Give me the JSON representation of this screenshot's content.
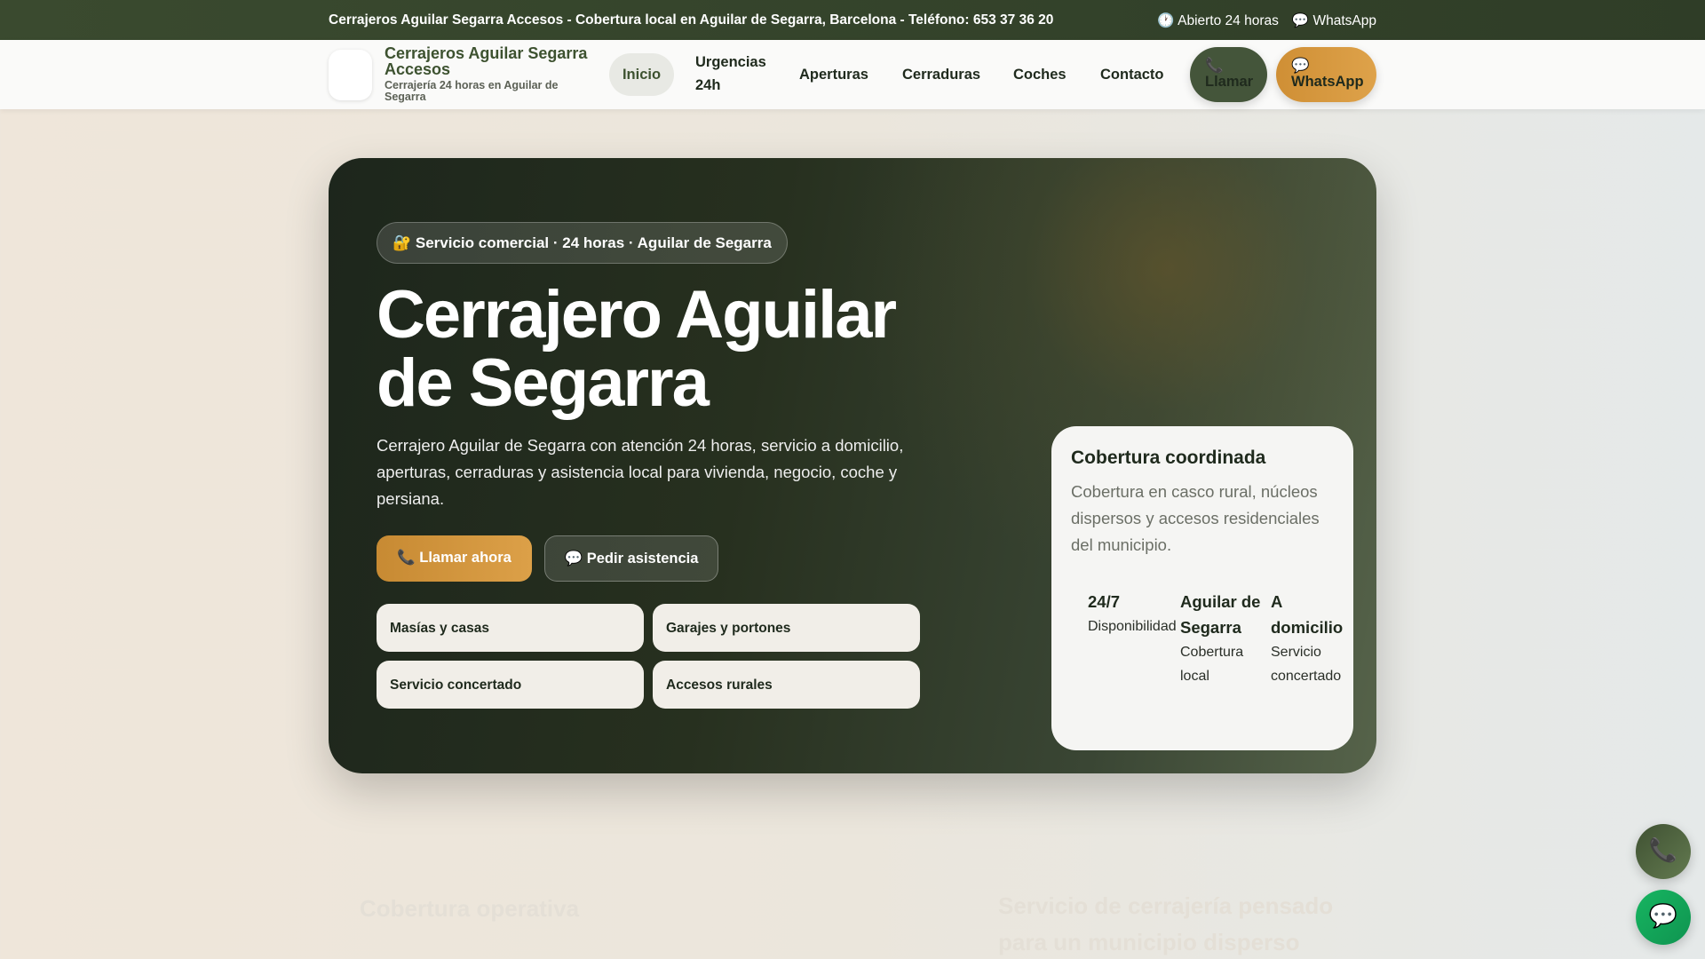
{
  "topbar": {
    "message": "Cerrajeros Aguilar Segarra Accesos - Cobertura local en Aguilar de Segarra, Barcelona - Teléfono: 653 37 36 20",
    "hours": "🕐 Abierto 24 horas",
    "whatsapp": "💬 WhatsApp"
  },
  "nav": {
    "brand_title": "Cerrajeros Aguilar Segarra Accesos",
    "brand_subtitle": "Cerrajería 24 horas en Aguilar de Segarra",
    "links": [
      "Inicio",
      "Urgencias 24h",
      "Aperturas",
      "Cerraduras",
      "Coches",
      "Contacto"
    ],
    "call_icon": "📞",
    "call_label": "Llamar",
    "wa_icon": "💬",
    "wa_label": "WhatsApp"
  },
  "hero": {
    "badge": "🔐 Servicio comercial · 24 horas · Aguilar de Segarra",
    "title": "Cerrajero Aguilar de Segarra",
    "lead": "Cerrajero Aguilar de Segarra con atención 24 horas, servicio a domicilio, aperturas, cerraduras y asistencia local para vivienda, negocio, coche y persiana.",
    "cta_call": "📞 Llamar ahora",
    "cta_help": "💬 Pedir asistencia",
    "chips": [
      "Masías y casas",
      "Garajes y portones",
      "Servicio concertado",
      "Accesos rurales"
    ]
  },
  "card": {
    "title": "Cobertura coordinada",
    "text": "Cobertura en casco rural, núcleos dispersos y accesos residenciales del municipio.",
    "stats": [
      {
        "value": "24/7",
        "label": "Disponibilidad"
      },
      {
        "value": "Aguilar de Segarra",
        "label": "Cobertura local"
      },
      {
        "value": "A domicilio",
        "label": "Servicio concertado"
      }
    ]
  },
  "below": {
    "left_heading": "Cobertura operativa",
    "right_heading": "Servicio de cerrajería pensado para un municipio disperso"
  },
  "fabs": {
    "phone": "📞",
    "whatsapp": "💬"
  },
  "colors": {
    "primary": "#3d5230",
    "accent": "#d4953a",
    "whatsapp": "#12a150"
  }
}
